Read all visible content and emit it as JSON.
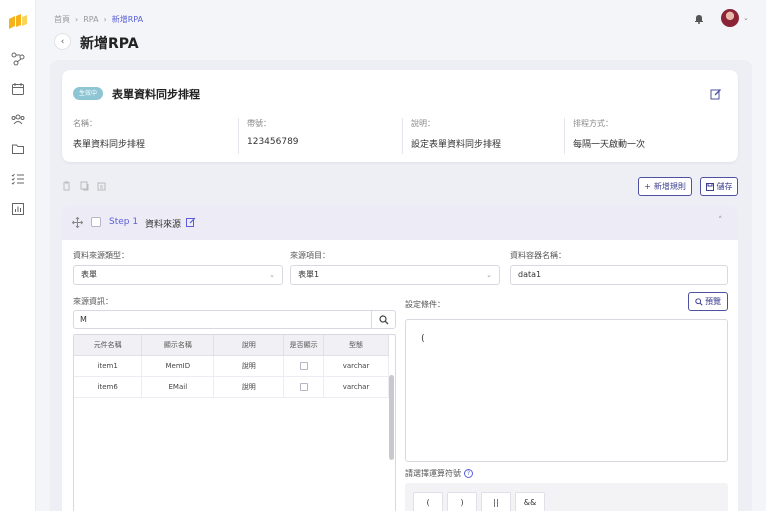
{
  "breadcrumb": [
    "首頁",
    "RPA",
    "新增RPA"
  ],
  "page_title": "新增RPA",
  "info": {
    "status_badge": "生效中",
    "title": "表單資料同步排程",
    "fields": [
      {
        "label": "名稱：",
        "value": "表單資料同步排程"
      },
      {
        "label": "帶號：",
        "value": "123456789"
      },
      {
        "label": "說明：",
        "value": "設定表單資料同步排程"
      },
      {
        "label": "排程方式：",
        "value": "每隔一天啟動一次"
      }
    ]
  },
  "actions": {
    "add_rule": "新增規則",
    "save": "儲存"
  },
  "step": {
    "label": "Step 1",
    "name": "資料來源",
    "source_type": {
      "label": "資料來源類型：",
      "value": "表單"
    },
    "source_item": {
      "label": "來源項目：",
      "value": "表單1"
    },
    "container": {
      "label": "資料容器名稱：",
      "value": "data1"
    },
    "source_fields": {
      "label": "來源資訊：",
      "search_value": "M"
    },
    "table": {
      "headers": [
        "元件名稱",
        "顯示名稱",
        "說明",
        "是否顯示",
        "型態"
      ],
      "rows": [
        {
          "name": "item1",
          "display": "MemID",
          "desc": "說明",
          "type": "varchar"
        },
        {
          "name": "item6",
          "display": "EMail",
          "desc": "說明",
          "type": "varchar"
        }
      ]
    },
    "condition": {
      "label": "設定條件：",
      "preview": "預覽",
      "content": "("
    },
    "operators": {
      "label": "請選擇運算符號",
      "items": [
        "(",
        ")",
        "||",
        "&&"
      ]
    }
  },
  "colors": {
    "accent": "#5a5fd8",
    "badge": "#8ec5d4",
    "button_border": "#4d519f"
  }
}
